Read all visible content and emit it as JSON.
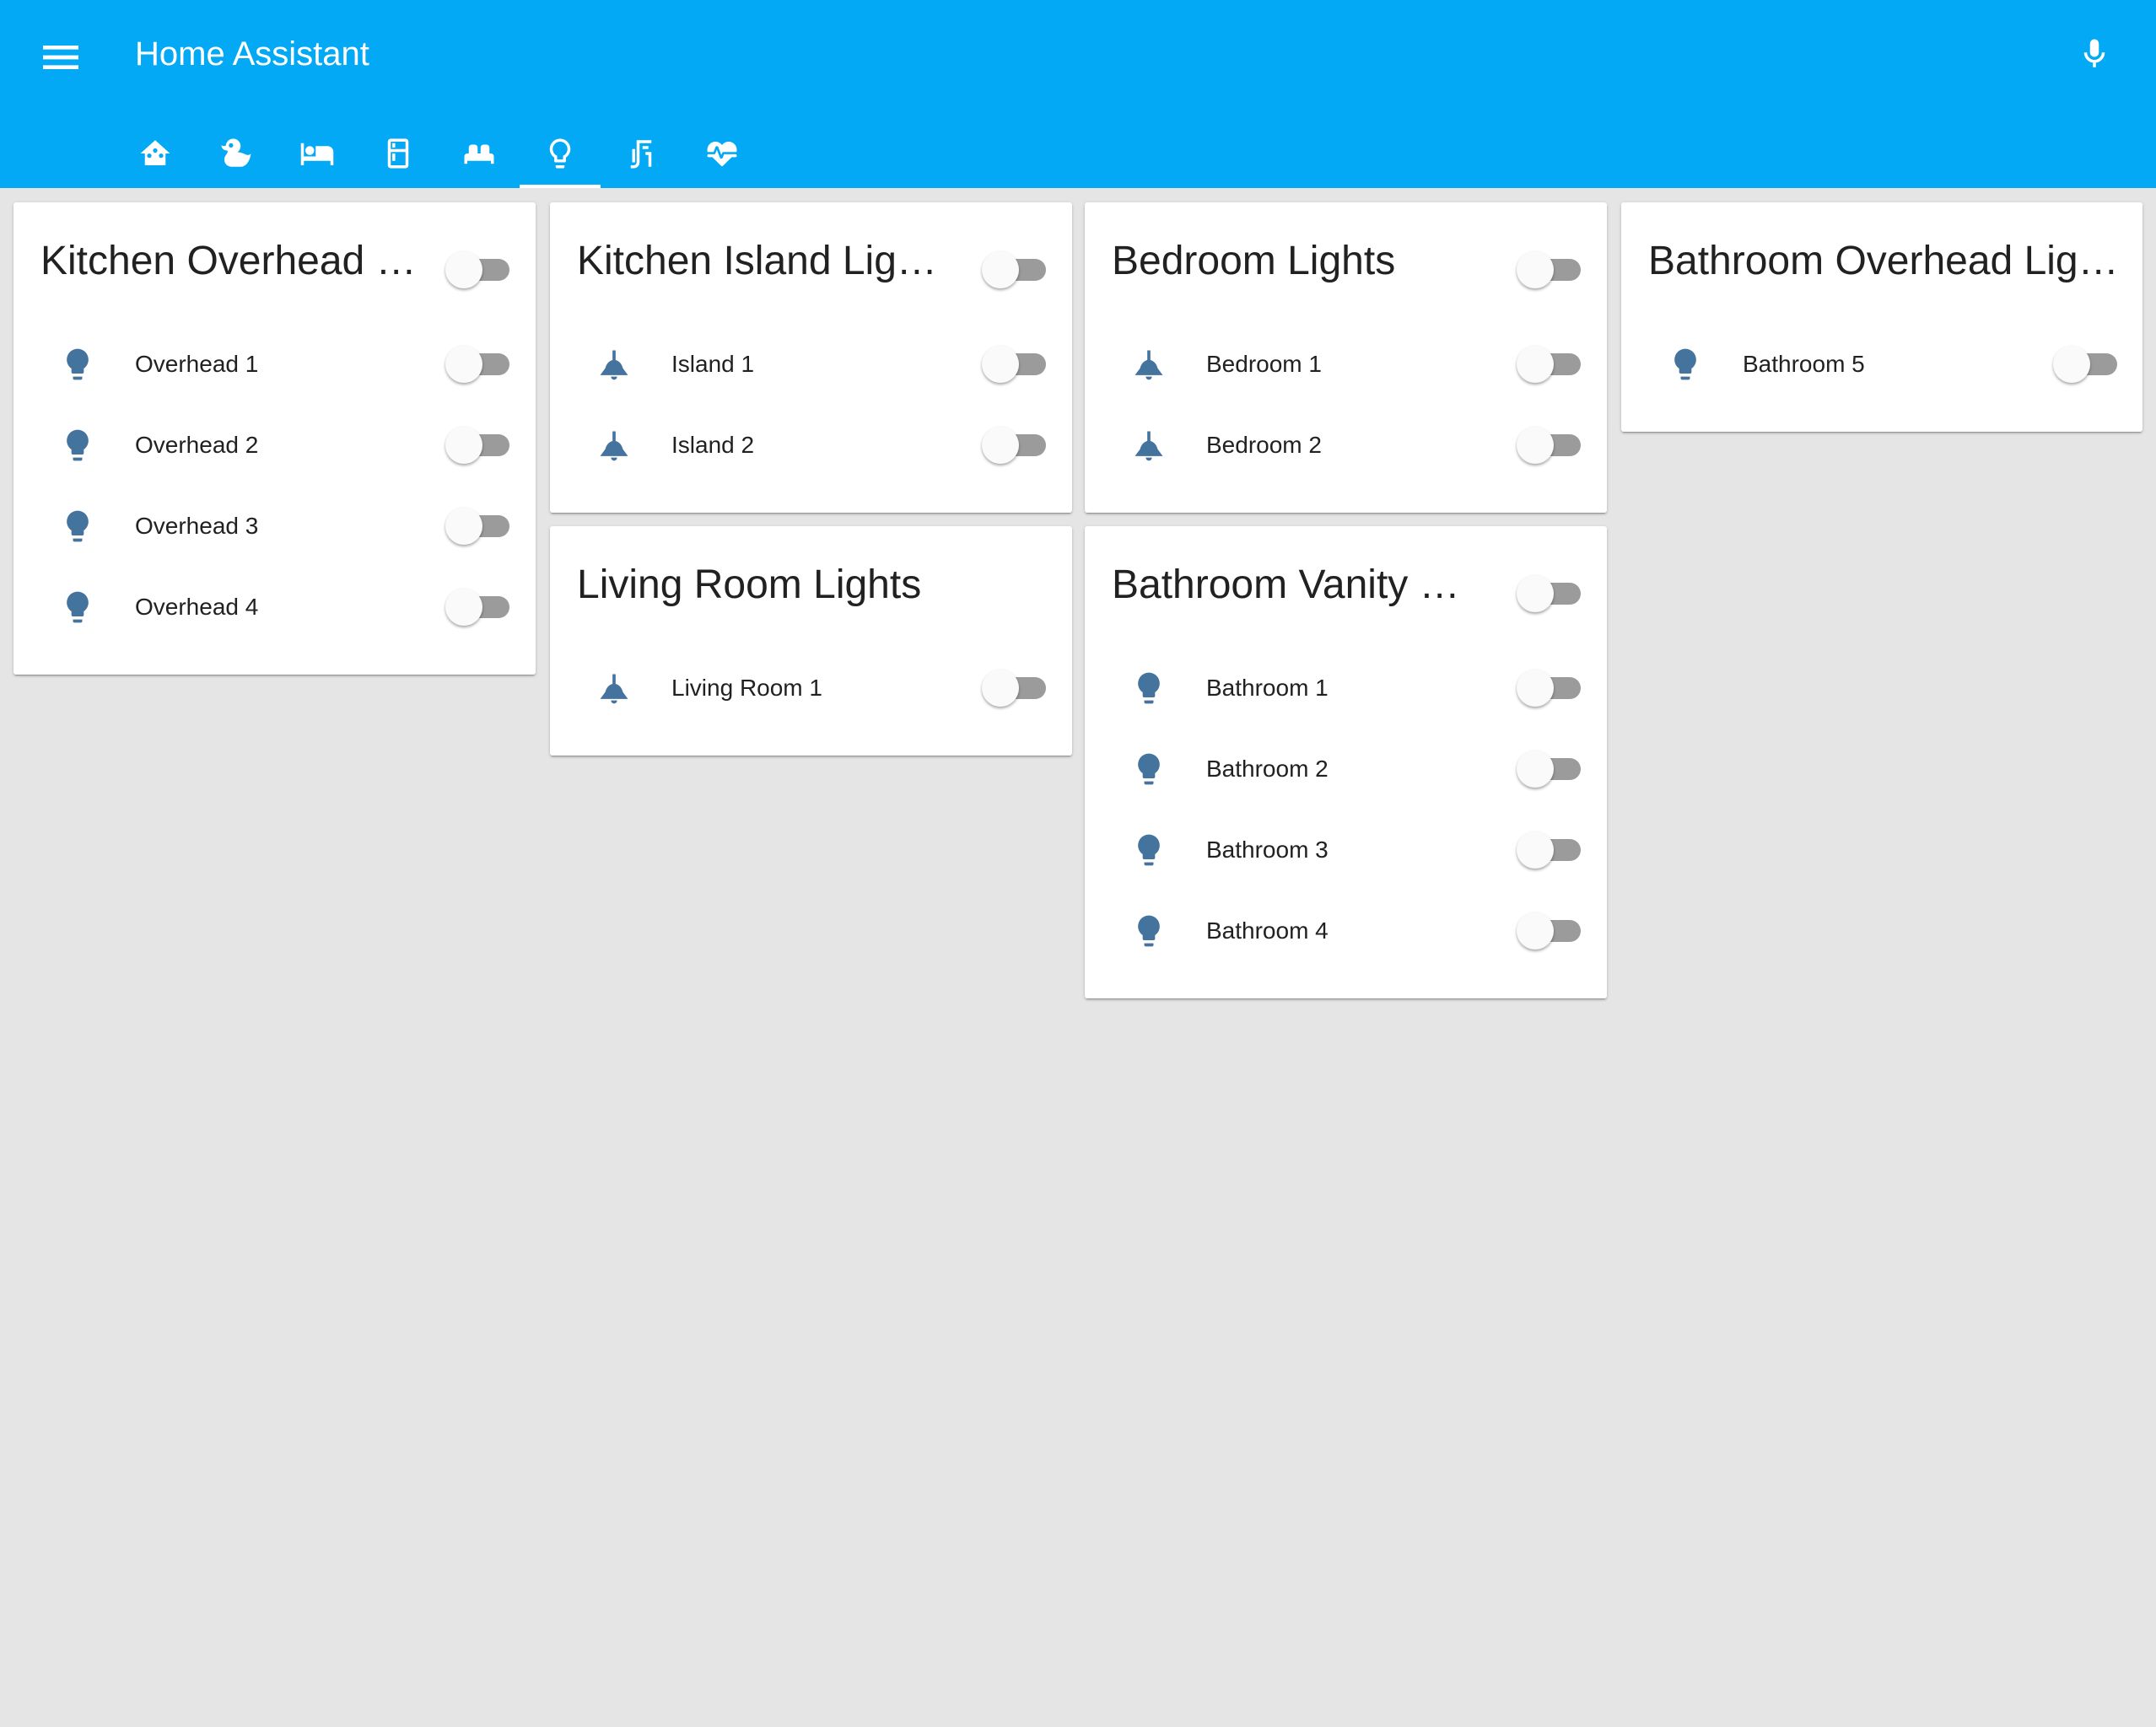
{
  "app": {
    "title": "Home Assistant",
    "accent_color": "#03a9f4",
    "icon_color": "#44739e"
  },
  "header": {
    "menu_icon": "menu-icon",
    "mic_icon": "microphone-icon"
  },
  "tabs": [
    {
      "icon": "home-assistant-icon",
      "active": false
    },
    {
      "icon": "duck-icon",
      "active": false
    },
    {
      "icon": "bed-icon",
      "active": false
    },
    {
      "icon": "fridge-icon",
      "active": false
    },
    {
      "icon": "sofa-icon",
      "active": false
    },
    {
      "icon": "lightbulb-outline-icon",
      "active": true
    },
    {
      "icon": "bathtub-icon",
      "active": false
    },
    {
      "icon": "heart-pulse-icon",
      "active": false
    }
  ],
  "cards": {
    "kitchen_overhead": {
      "title": "Kitchen Overhead Lights",
      "state": "off",
      "entities": [
        {
          "label": "Overhead 1",
          "icon": "lightbulb-icon",
          "state": "off"
        },
        {
          "label": "Overhead 2",
          "icon": "lightbulb-icon",
          "state": "off"
        },
        {
          "label": "Overhead 3",
          "icon": "lightbulb-icon",
          "state": "off"
        },
        {
          "label": "Overhead 4",
          "icon": "lightbulb-icon",
          "state": "off"
        }
      ]
    },
    "kitchen_island": {
      "title": "Kitchen Island Lights",
      "state": "off",
      "entities": [
        {
          "label": "Island 1",
          "icon": "ceiling-light-icon",
          "state": "off"
        },
        {
          "label": "Island 2",
          "icon": "ceiling-light-icon",
          "state": "off"
        }
      ]
    },
    "living_room": {
      "title": "Living Room Lights",
      "entities": [
        {
          "label": "Living Room 1",
          "icon": "ceiling-light-icon",
          "state": "off"
        }
      ]
    },
    "bedroom": {
      "title": "Bedroom Lights",
      "state": "off",
      "entities": [
        {
          "label": "Bedroom 1",
          "icon": "ceiling-light-icon",
          "state": "off"
        },
        {
          "label": "Bedroom 2",
          "icon": "ceiling-light-icon",
          "state": "off"
        }
      ]
    },
    "bathroom_vanity": {
      "title": "Bathroom Vanity Lights",
      "state": "off",
      "entities": [
        {
          "label": "Bathroom 1",
          "icon": "lightbulb-icon",
          "state": "off"
        },
        {
          "label": "Bathroom 2",
          "icon": "lightbulb-icon",
          "state": "off"
        },
        {
          "label": "Bathroom 3",
          "icon": "lightbulb-icon",
          "state": "off"
        },
        {
          "label": "Bathroom 4",
          "icon": "lightbulb-icon",
          "state": "off"
        }
      ]
    },
    "bathroom_overhead": {
      "title": "Bathroom Overhead Lights",
      "entities": [
        {
          "label": "Bathroom 5",
          "icon": "lightbulb-icon",
          "state": "off"
        }
      ]
    }
  }
}
